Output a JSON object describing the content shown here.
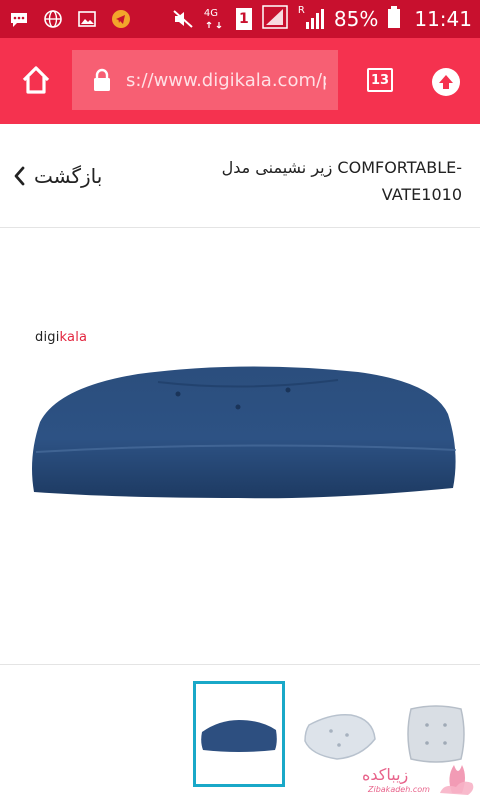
{
  "status_bar": {
    "network": "4G",
    "sim_slot": "1",
    "roaming": "R",
    "battery": "85%",
    "time": "11:41"
  },
  "browser": {
    "url": "s://www.digikala.com/p",
    "tab_count": "13"
  },
  "product_page": {
    "back_label": "بازگشت",
    "title": "زیر نشیمنی مدل COMFORTABLE-VATE1010"
  },
  "gallery": {
    "logo_part1": "digi",
    "logo_part2": "kala"
  },
  "watermark": {
    "text": "زیباکده",
    "subtext": "Zibakadeh.com"
  },
  "colors": {
    "status_bar": "#c8102e",
    "browser_bar": "#f5324f",
    "cushion": "#2d4f80",
    "thumb_highlight": "#19a8c8"
  }
}
